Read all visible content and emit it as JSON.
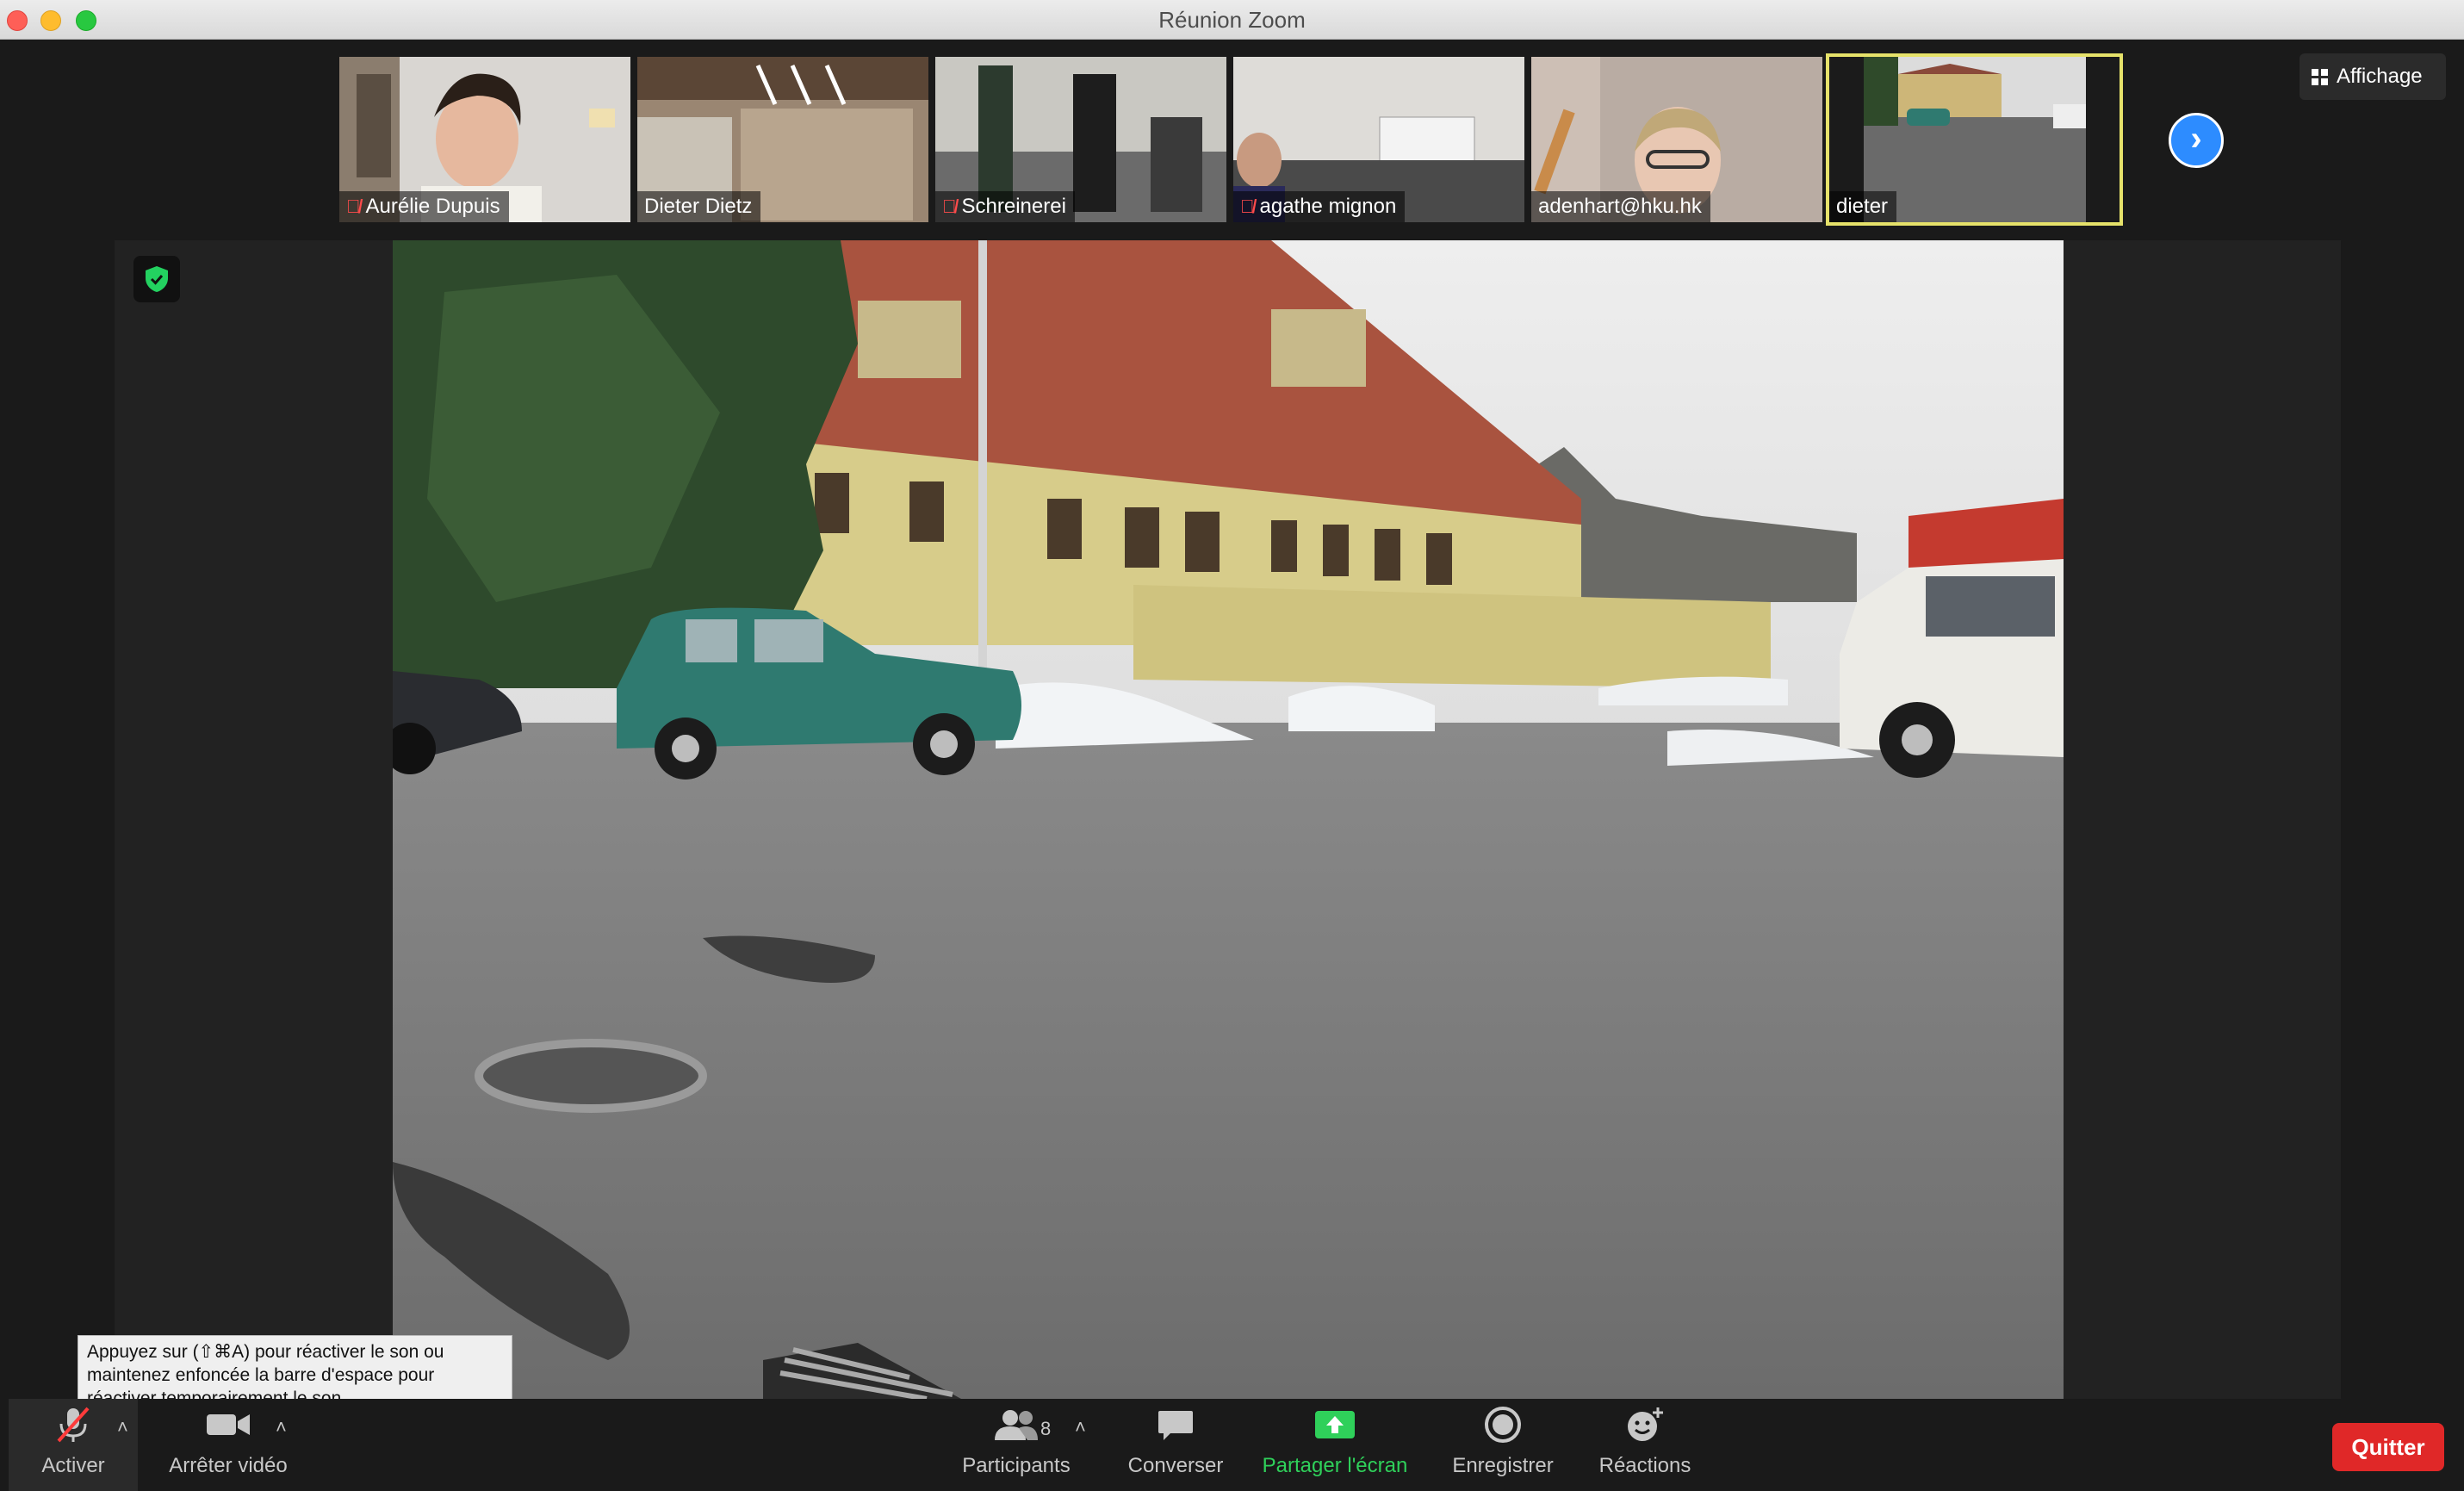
{
  "window": {
    "title": "Réunion Zoom"
  },
  "participants_strip": [
    {
      "name": "Aurélie Dupuis",
      "muted": true
    },
    {
      "name": "Dieter Dietz",
      "muted": false
    },
    {
      "name": "Schreinerei",
      "muted": true
    },
    {
      "name": "agathe mignon",
      "muted": true
    },
    {
      "name": "adenhart@hku.hk",
      "muted": false
    },
    {
      "name": "dieter",
      "muted": false,
      "active_speaker": true
    }
  ],
  "view_button": {
    "label": "Affichage",
    "icon": "grid-icon"
  },
  "next_page_icon": "chevron-right-icon",
  "tooltip": {
    "text": "Appuyez sur  (⇧⌘A) pour réactiver le son ou maintenez enfoncée la barre d'espace pour réactiver temporairement le son."
  },
  "toolbar": {
    "mute_label": "Activer",
    "video_label": "Arrêter vidéo",
    "participants_label": "Participants",
    "participants_count": "8",
    "chat_label": "Converser",
    "share_label": "Partager l'écran",
    "record_label": "Enregistrer",
    "reactions_label": "Réactions",
    "quit_label": "Quitter"
  },
  "colors": {
    "share_green": "#2fd05a",
    "quit_red": "#e02828",
    "active_speaker_border": "#e6e26a",
    "accent_blue": "#2d8cff"
  }
}
